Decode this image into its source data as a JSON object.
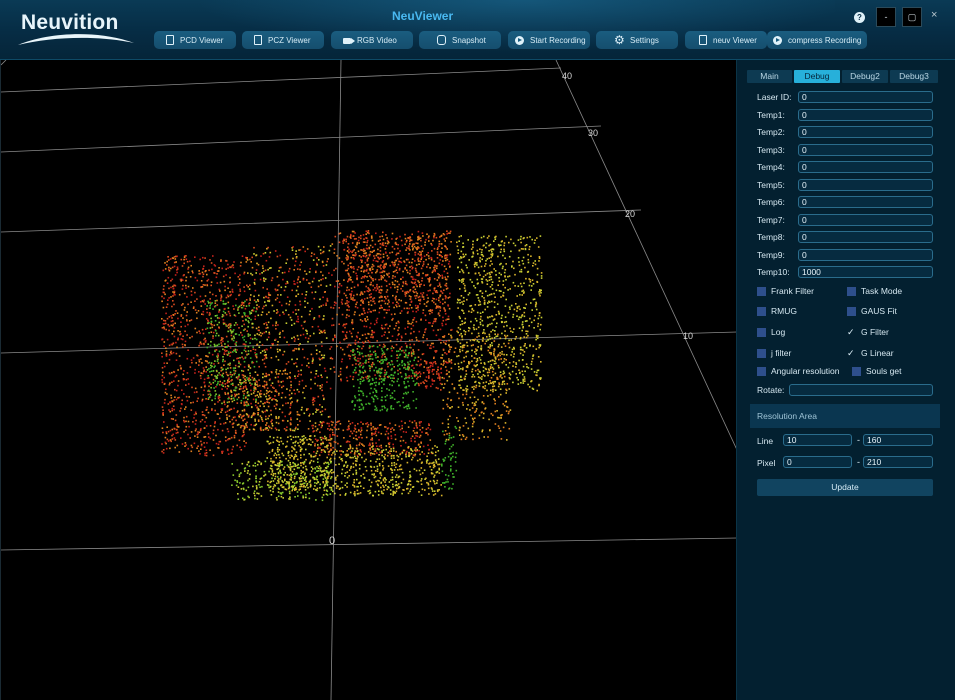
{
  "app": {
    "logo_text": "Neuvition",
    "title": "NeuViewer",
    "accent_color": "#49b8f0"
  },
  "toolbar": [
    {
      "label": "PCD Viewer",
      "icon": "document-icon"
    },
    {
      "label": "PCZ Viewer",
      "icon": "document-icon"
    },
    {
      "label": "RGB Video",
      "icon": "video-camera-icon"
    },
    {
      "label": "Snapshot",
      "icon": "database-icon"
    },
    {
      "label": "Start Recording",
      "icon": "record-icon"
    },
    {
      "label": "Settings",
      "icon": "gear-icon"
    },
    {
      "label": "neuv Viewer",
      "icon": "document-icon"
    },
    {
      "label": "compress Recording",
      "icon": "record-icon"
    }
  ],
  "window_controls": {
    "help": "?",
    "minimize": "-",
    "maximize": "▢",
    "close": "×"
  },
  "viewport": {
    "grid_labels": [
      "40",
      "30",
      "20",
      "10",
      "0"
    ],
    "point_colors": [
      "#c4211b",
      "#d84a1e",
      "#e0801f",
      "#d9b42a",
      "#c9cf33",
      "#86c92c",
      "#3fb02a"
    ]
  },
  "panel": {
    "tabs": [
      "Main",
      "Debug",
      "Debug2",
      "Debug3"
    ],
    "active_tab": "Debug",
    "fields": [
      {
        "label": "Laser ID:",
        "value": "0"
      },
      {
        "label": "Temp1:",
        "value": "0"
      },
      {
        "label": "Temp2:",
        "value": "0"
      },
      {
        "label": "Temp3:",
        "value": "0"
      },
      {
        "label": "Temp4:",
        "value": "0"
      },
      {
        "label": "Temp5:",
        "value": "0"
      },
      {
        "label": "Temp6:",
        "value": "0"
      },
      {
        "label": "Temp7:",
        "value": "0"
      },
      {
        "label": "Temp8:",
        "value": "0"
      },
      {
        "label": "Temp9:",
        "value": "0"
      },
      {
        "label": "Temp10:",
        "value": "1000"
      }
    ],
    "checkboxes": [
      {
        "label": "Frank Filter",
        "checked": false
      },
      {
        "label": "Task Mode",
        "checked": false
      },
      {
        "label": "RMUG",
        "checked": false
      },
      {
        "label": "GAUS Fit",
        "checked": false
      },
      {
        "label": "Log",
        "checked": false
      },
      {
        "label": "G Filter",
        "checked": true
      },
      {
        "label": "j filter",
        "checked": false
      },
      {
        "label": "G Linear",
        "checked": true
      },
      {
        "label": "Angular resolution",
        "checked": false
      },
      {
        "label": "Souls get",
        "checked": false
      }
    ],
    "rotate_label": "Rotate:",
    "rotate_value": "",
    "resolution_area_label": "Resolution Area",
    "line_label": "Line",
    "line_from": "10",
    "line_to": "160",
    "pixel_label": "Pixel",
    "pixel_from": "0",
    "pixel_to": "210",
    "range_separator": "-",
    "update_label": "Update"
  }
}
